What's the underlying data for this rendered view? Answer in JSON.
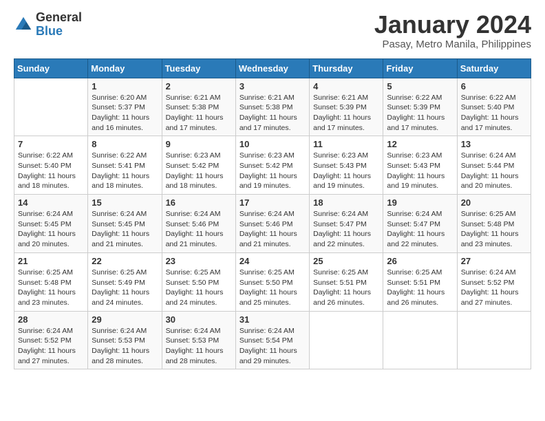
{
  "logo": {
    "general": "General",
    "blue": "Blue"
  },
  "title": "January 2024",
  "subtitle": "Pasay, Metro Manila, Philippines",
  "days_of_week": [
    "Sunday",
    "Monday",
    "Tuesday",
    "Wednesday",
    "Thursday",
    "Friday",
    "Saturday"
  ],
  "weeks": [
    [
      {
        "day": "",
        "sunrise": "",
        "sunset": "",
        "daylight": ""
      },
      {
        "day": "1",
        "sunrise": "Sunrise: 6:20 AM",
        "sunset": "Sunset: 5:37 PM",
        "daylight": "Daylight: 11 hours and 16 minutes."
      },
      {
        "day": "2",
        "sunrise": "Sunrise: 6:21 AM",
        "sunset": "Sunset: 5:38 PM",
        "daylight": "Daylight: 11 hours and 17 minutes."
      },
      {
        "day": "3",
        "sunrise": "Sunrise: 6:21 AM",
        "sunset": "Sunset: 5:38 PM",
        "daylight": "Daylight: 11 hours and 17 minutes."
      },
      {
        "day": "4",
        "sunrise": "Sunrise: 6:21 AM",
        "sunset": "Sunset: 5:39 PM",
        "daylight": "Daylight: 11 hours and 17 minutes."
      },
      {
        "day": "5",
        "sunrise": "Sunrise: 6:22 AM",
        "sunset": "Sunset: 5:39 PM",
        "daylight": "Daylight: 11 hours and 17 minutes."
      },
      {
        "day": "6",
        "sunrise": "Sunrise: 6:22 AM",
        "sunset": "Sunset: 5:40 PM",
        "daylight": "Daylight: 11 hours and 17 minutes."
      }
    ],
    [
      {
        "day": "7",
        "sunrise": "Sunrise: 6:22 AM",
        "sunset": "Sunset: 5:40 PM",
        "daylight": "Daylight: 11 hours and 18 minutes."
      },
      {
        "day": "8",
        "sunrise": "Sunrise: 6:22 AM",
        "sunset": "Sunset: 5:41 PM",
        "daylight": "Daylight: 11 hours and 18 minutes."
      },
      {
        "day": "9",
        "sunrise": "Sunrise: 6:23 AM",
        "sunset": "Sunset: 5:42 PM",
        "daylight": "Daylight: 11 hours and 18 minutes."
      },
      {
        "day": "10",
        "sunrise": "Sunrise: 6:23 AM",
        "sunset": "Sunset: 5:42 PM",
        "daylight": "Daylight: 11 hours and 19 minutes."
      },
      {
        "day": "11",
        "sunrise": "Sunrise: 6:23 AM",
        "sunset": "Sunset: 5:43 PM",
        "daylight": "Daylight: 11 hours and 19 minutes."
      },
      {
        "day": "12",
        "sunrise": "Sunrise: 6:23 AM",
        "sunset": "Sunset: 5:43 PM",
        "daylight": "Daylight: 11 hours and 19 minutes."
      },
      {
        "day": "13",
        "sunrise": "Sunrise: 6:24 AM",
        "sunset": "Sunset: 5:44 PM",
        "daylight": "Daylight: 11 hours and 20 minutes."
      }
    ],
    [
      {
        "day": "14",
        "sunrise": "Sunrise: 6:24 AM",
        "sunset": "Sunset: 5:45 PM",
        "daylight": "Daylight: 11 hours and 20 minutes."
      },
      {
        "day": "15",
        "sunrise": "Sunrise: 6:24 AM",
        "sunset": "Sunset: 5:45 PM",
        "daylight": "Daylight: 11 hours and 21 minutes."
      },
      {
        "day": "16",
        "sunrise": "Sunrise: 6:24 AM",
        "sunset": "Sunset: 5:46 PM",
        "daylight": "Daylight: 11 hours and 21 minutes."
      },
      {
        "day": "17",
        "sunrise": "Sunrise: 6:24 AM",
        "sunset": "Sunset: 5:46 PM",
        "daylight": "Daylight: 11 hours and 21 minutes."
      },
      {
        "day": "18",
        "sunrise": "Sunrise: 6:24 AM",
        "sunset": "Sunset: 5:47 PM",
        "daylight": "Daylight: 11 hours and 22 minutes."
      },
      {
        "day": "19",
        "sunrise": "Sunrise: 6:24 AM",
        "sunset": "Sunset: 5:47 PM",
        "daylight": "Daylight: 11 hours and 22 minutes."
      },
      {
        "day": "20",
        "sunrise": "Sunrise: 6:25 AM",
        "sunset": "Sunset: 5:48 PM",
        "daylight": "Daylight: 11 hours and 23 minutes."
      }
    ],
    [
      {
        "day": "21",
        "sunrise": "Sunrise: 6:25 AM",
        "sunset": "Sunset: 5:48 PM",
        "daylight": "Daylight: 11 hours and 23 minutes."
      },
      {
        "day": "22",
        "sunrise": "Sunrise: 6:25 AM",
        "sunset": "Sunset: 5:49 PM",
        "daylight": "Daylight: 11 hours and 24 minutes."
      },
      {
        "day": "23",
        "sunrise": "Sunrise: 6:25 AM",
        "sunset": "Sunset: 5:50 PM",
        "daylight": "Daylight: 11 hours and 24 minutes."
      },
      {
        "day": "24",
        "sunrise": "Sunrise: 6:25 AM",
        "sunset": "Sunset: 5:50 PM",
        "daylight": "Daylight: 11 hours and 25 minutes."
      },
      {
        "day": "25",
        "sunrise": "Sunrise: 6:25 AM",
        "sunset": "Sunset: 5:51 PM",
        "daylight": "Daylight: 11 hours and 26 minutes."
      },
      {
        "day": "26",
        "sunrise": "Sunrise: 6:25 AM",
        "sunset": "Sunset: 5:51 PM",
        "daylight": "Daylight: 11 hours and 26 minutes."
      },
      {
        "day": "27",
        "sunrise": "Sunrise: 6:24 AM",
        "sunset": "Sunset: 5:52 PM",
        "daylight": "Daylight: 11 hours and 27 minutes."
      }
    ],
    [
      {
        "day": "28",
        "sunrise": "Sunrise: 6:24 AM",
        "sunset": "Sunset: 5:52 PM",
        "daylight": "Daylight: 11 hours and 27 minutes."
      },
      {
        "day": "29",
        "sunrise": "Sunrise: 6:24 AM",
        "sunset": "Sunset: 5:53 PM",
        "daylight": "Daylight: 11 hours and 28 minutes."
      },
      {
        "day": "30",
        "sunrise": "Sunrise: 6:24 AM",
        "sunset": "Sunset: 5:53 PM",
        "daylight": "Daylight: 11 hours and 28 minutes."
      },
      {
        "day": "31",
        "sunrise": "Sunrise: 6:24 AM",
        "sunset": "Sunset: 5:54 PM",
        "daylight": "Daylight: 11 hours and 29 minutes."
      },
      {
        "day": "",
        "sunrise": "",
        "sunset": "",
        "daylight": ""
      },
      {
        "day": "",
        "sunrise": "",
        "sunset": "",
        "daylight": ""
      },
      {
        "day": "",
        "sunrise": "",
        "sunset": "",
        "daylight": ""
      }
    ]
  ]
}
